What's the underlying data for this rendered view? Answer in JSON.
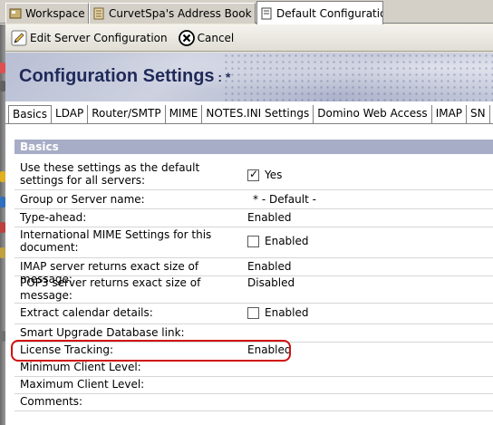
{
  "window_tabs": [
    {
      "label": "Workspace",
      "active": false,
      "closable": false
    },
    {
      "label": "CurvetSpa's Address Book - ...",
      "active": false,
      "closable": false
    },
    {
      "label": "Default Configuration",
      "active": true,
      "closable": true
    }
  ],
  "toolbar": {
    "edit_label": "Edit Server Configuration",
    "cancel_label": "Cancel"
  },
  "header": {
    "title": "Configuration Settings",
    "suffix": " : *"
  },
  "content_tabs": [
    "Basics",
    "LDAP",
    "Router/SMTP",
    "MIME",
    "NOTES.INI Settings",
    "Domino Web Access",
    "IMAP",
    "SN"
  ],
  "section_title": "Basics",
  "fields": [
    {
      "label": "Use these settings as the default settings for all servers:",
      "value": "Yes",
      "checkbox": true,
      "checked": true
    },
    {
      "label": "Group or Server name:",
      "value": "* - Default -"
    },
    {
      "label": "Type-ahead:",
      "value": "Enabled"
    },
    {
      "label": "International MIME Settings for this document:",
      "value": "Enabled",
      "checkbox": true,
      "checked": false
    },
    {
      "label": "IMAP server returns exact size of message:",
      "value": "Enabled"
    },
    {
      "label": "POP3 server returns exact size of message:",
      "value": "Disabled"
    },
    {
      "label": "Extract calendar details:",
      "value": "Enabled",
      "checkbox": true,
      "checked": false
    },
    {
      "label": "Smart Upgrade Database link:",
      "value": ""
    },
    {
      "label": "License Tracking:",
      "value": "Enabled"
    },
    {
      "label": "Minimum Client Level:",
      "value": ""
    },
    {
      "label": "Maximum Client Level:",
      "value": ""
    },
    {
      "label": "Comments:",
      "value": ""
    }
  ],
  "colors": {
    "section_bar": "#a7adc6",
    "title": "#1f2a5a",
    "highlight": "#d01010"
  }
}
